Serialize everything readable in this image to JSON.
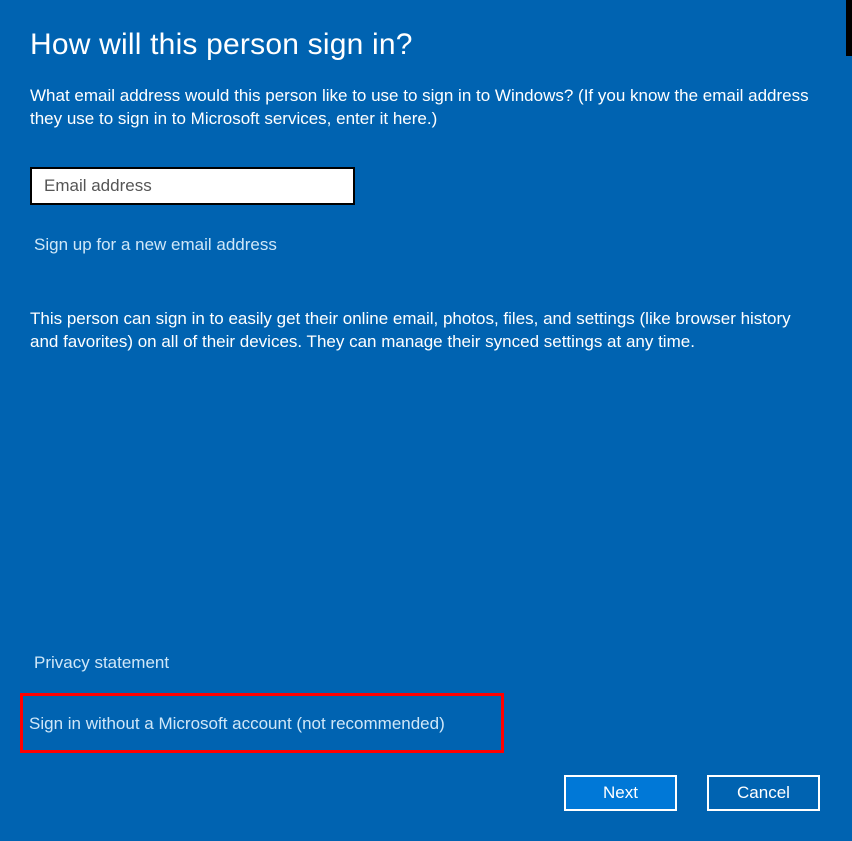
{
  "title": "How will this person sign in?",
  "intro": "What email address would this person like to use to sign in to Windows? (If you know the email address they use to sign in to Microsoft services, enter it here.)",
  "email": {
    "value": "",
    "placeholder": "Email address"
  },
  "links": {
    "signup": "Sign up for a new email address",
    "privacy": "Privacy statement",
    "local_account": "Sign in without a Microsoft account (not recommended)"
  },
  "description": "This person can sign in to easily get their online email, photos, files, and settings (like browser history and favorites) on all of their devices. They can manage their synced settings at any time.",
  "buttons": {
    "next": "Next",
    "cancel": "Cancel"
  }
}
